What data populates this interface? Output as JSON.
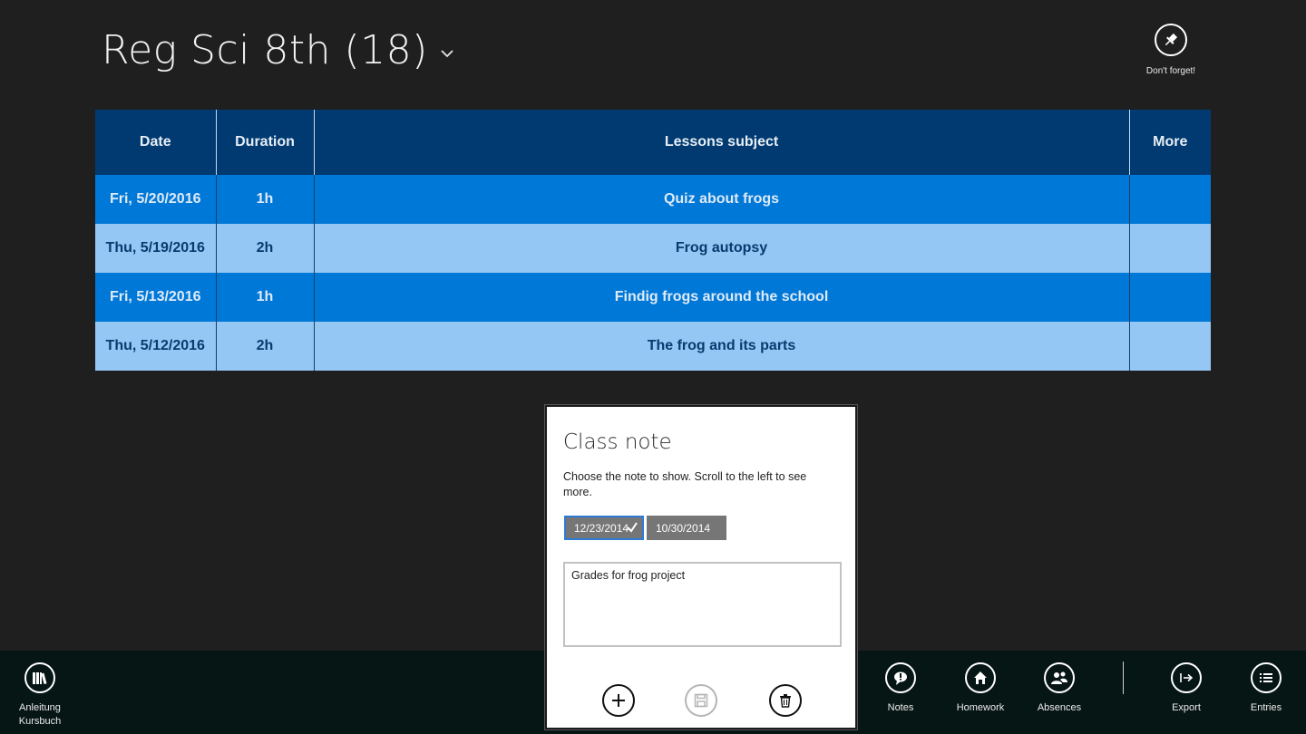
{
  "header": {
    "title": "Reg Sci 8th (18)",
    "pin_label": "Don't forget!"
  },
  "table": {
    "columns": [
      "Date",
      "Duration",
      "Lessons subject",
      "More"
    ],
    "rows": [
      {
        "date": "Fri, 5/20/2016",
        "duration": "1h",
        "subject": "Quiz about frogs",
        "more": ""
      },
      {
        "date": "Thu, 5/19/2016",
        "duration": "2h",
        "subject": "Frog autopsy",
        "more": ""
      },
      {
        "date": "Fri, 5/13/2016",
        "duration": "1h",
        "subject": "Findig frogs around the school",
        "more": ""
      },
      {
        "date": "Thu, 5/12/2016",
        "duration": "2h",
        "subject": "The frog and its parts",
        "more": ""
      }
    ]
  },
  "class_note": {
    "title": "Class note",
    "description": "Choose the note to show. Scroll to the left to see more.",
    "dates": [
      "12/23/2014",
      "10/30/2014"
    ],
    "selected_date": "12/23/2014",
    "note_text": "Grades for frog project",
    "actions": [
      "add-icon",
      "save-icon",
      "delete-icon"
    ]
  },
  "appbar": {
    "left": {
      "label_line1": "Anleitung",
      "label_line2": "Kursbuch",
      "icon": "books-icon"
    },
    "notes": {
      "label": "Notes",
      "icon": "speech-bubble-icon"
    },
    "homework": {
      "label": "Homework",
      "icon": "house-icon"
    },
    "absences": {
      "label": "Absences",
      "icon": "people-icon"
    },
    "export": {
      "label": "Export",
      "icon": "export-arrow-icon"
    },
    "entries": {
      "label": "Entries",
      "icon": "list-icon"
    }
  },
  "colors": {
    "background": "#1f1f1f",
    "header_row": "#003a70",
    "row_dark": "#0078d7",
    "row_light": "#94c7f4",
    "appbar": "#061614",
    "chip": "#767676",
    "chip_selected_border": "#2d7bd6"
  }
}
